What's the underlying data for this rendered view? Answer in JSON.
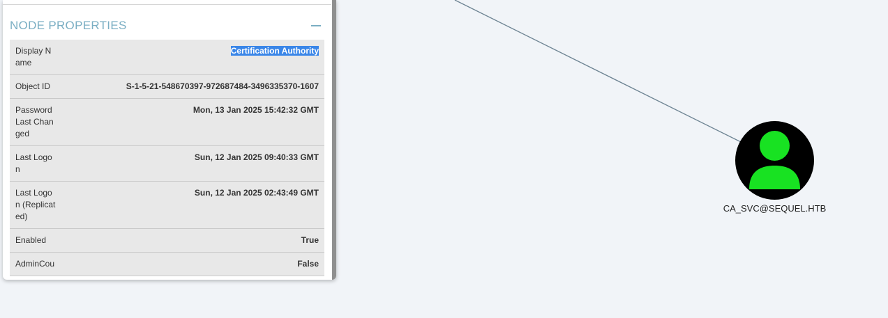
{
  "panel": {
    "section_title": "NODE PROPERTIES",
    "properties": [
      {
        "key": "Display Name",
        "value": "Certification Authority"
      },
      {
        "key": "Object ID",
        "value": "S-1-5-21-548670397-972687484-3496335370-1607"
      },
      {
        "key": "Password Last Changed",
        "value": "Mon, 13 Jan 2025 15:42:32 GMT"
      },
      {
        "key": "Last Logon",
        "value": "Sun, 12 Jan 2025 09:40:33 GMT"
      },
      {
        "key": "Last Logon (Replicated)",
        "value": "Sun, 12 Jan 2025 02:43:49 GMT"
      },
      {
        "key": "Enabled",
        "value": "True"
      },
      {
        "key": "AdminCou",
        "value": "False"
      }
    ]
  },
  "graph": {
    "node_label": "CA_SVC@SEQUEL.HTB",
    "node_color": "#18e222",
    "edge_color": "#6f8594"
  }
}
